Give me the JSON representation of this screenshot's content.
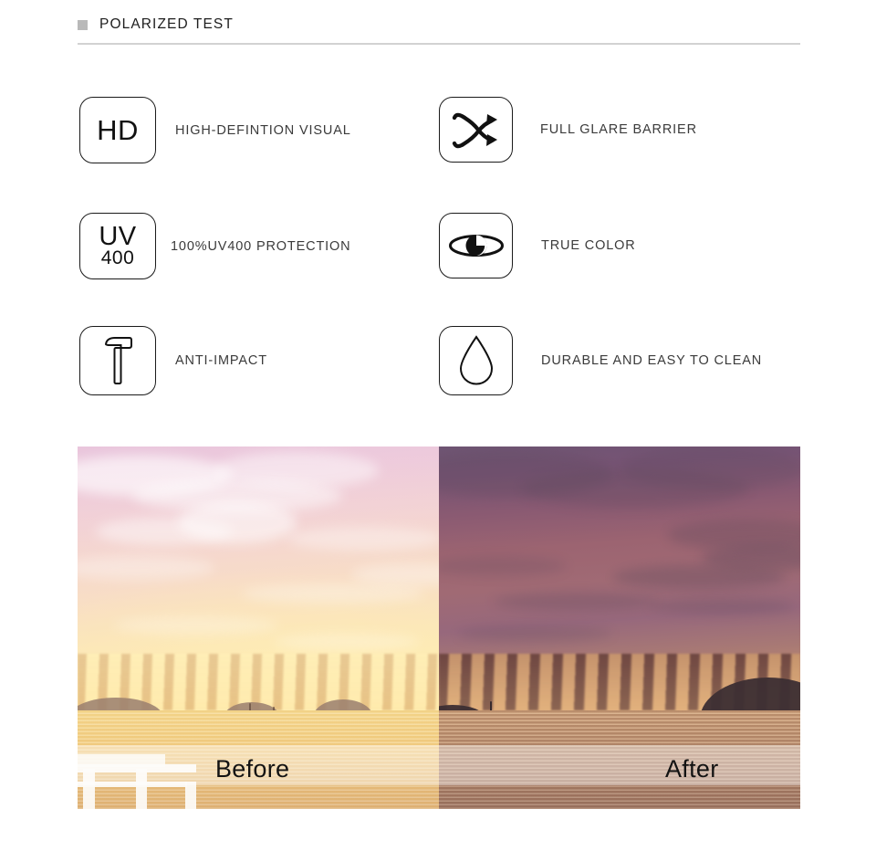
{
  "section": {
    "title": "POLARIZED TEST",
    "marker_icon": "square-marker-icon",
    "marker_color": "#b9b9b9",
    "rule_color": "#d2d2d2"
  },
  "features": [
    {
      "id": "hd",
      "icon": "hd-text-icon",
      "glyph": "HD",
      "label": "HIGH-DEFINTION VISUAL",
      "column": "left",
      "row": 1
    },
    {
      "id": "glare",
      "icon": "crossing-arrows-icon",
      "glyph": "",
      "label": "FULL GLARE BARRIER",
      "column": "right",
      "row": 1
    },
    {
      "id": "uv400",
      "icon": "uv400-text-icon",
      "glyph_top": "UV",
      "glyph_bottom": "400",
      "label": "100%UV400 PROTECTION",
      "column": "left",
      "row": 2
    },
    {
      "id": "truecolor",
      "icon": "eye-icon",
      "glyph": "",
      "label": "TRUE COLOR",
      "column": "right",
      "row": 2
    },
    {
      "id": "antiimpact",
      "icon": "hammer-icon",
      "glyph": "",
      "label": "ANTI-IMPACT",
      "column": "left",
      "row": 3
    },
    {
      "id": "durable",
      "icon": "water-drop-icon",
      "glyph": "",
      "label": "DURABLE AND EASY TO CLEAN",
      "column": "right",
      "row": 3
    }
  ],
  "comparison": {
    "before": {
      "label": "Before",
      "description": "washed-out pastel sunset seascape, low contrast"
    },
    "after": {
      "label": "After",
      "description": "saturated purple-orange sunset seascape, high contrast"
    }
  },
  "colors": {
    "text_dark": "#1d1d1d",
    "text_label": "#3b3b3b",
    "icon_stroke": "#1a1a1a",
    "page_background": "#ffffff"
  }
}
